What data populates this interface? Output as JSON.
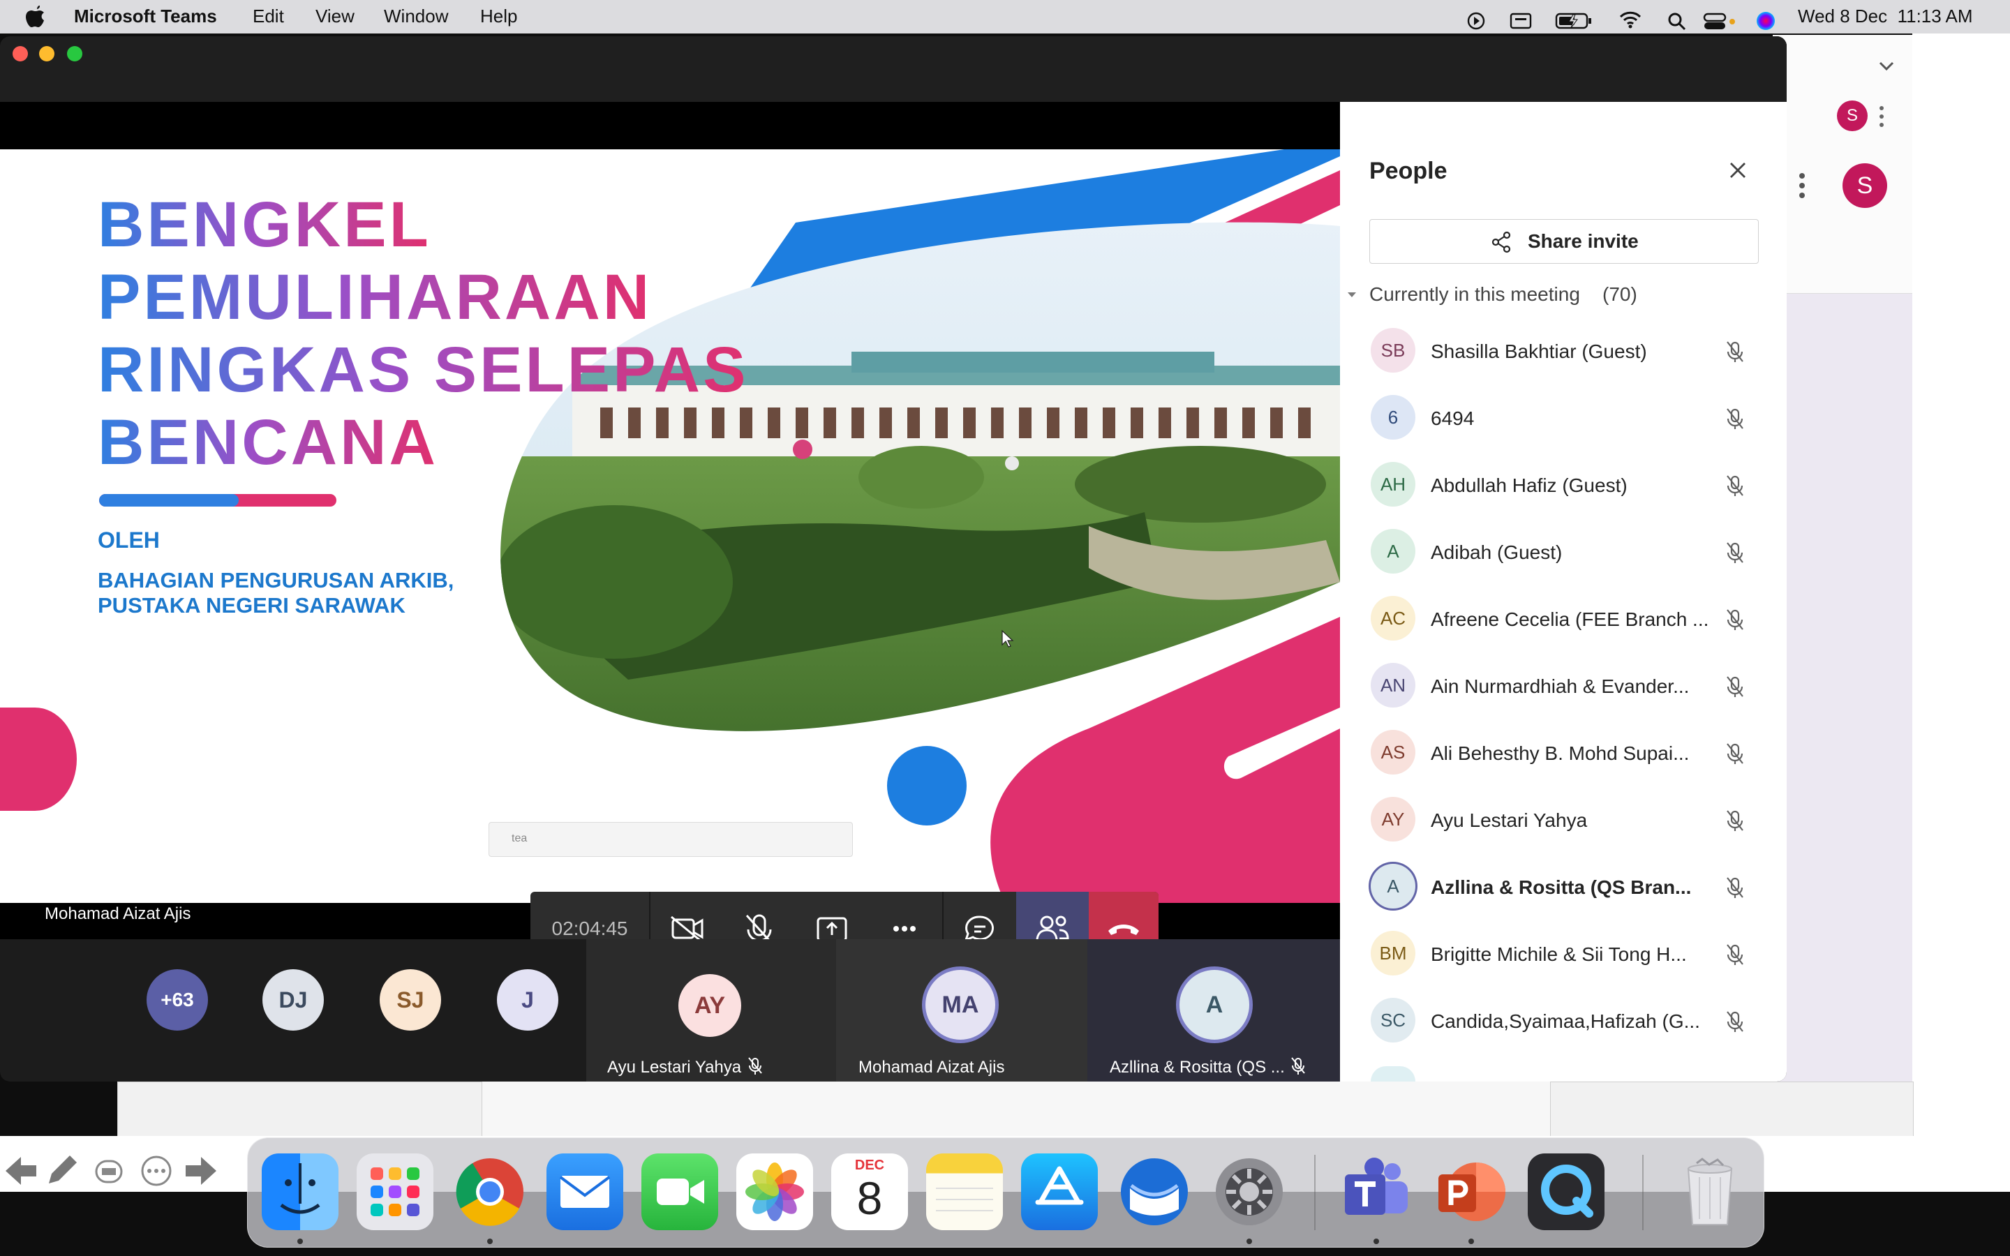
{
  "menubar": {
    "app_name": "Microsoft Teams",
    "menus": [
      "Edit",
      "View",
      "Window",
      "Help"
    ],
    "datetime": "Wed 8 Dec  11:13 AM"
  },
  "slide": {
    "title_lines": [
      "BENGKEL",
      "PEMULIHARAAN",
      "RINGKAS SELEPAS",
      "BENCANA"
    ],
    "by_label": "OLEH",
    "org_lines": [
      "BAHAGIAN PENGURUSAN ARKIB,",
      "PUSTAKA NEGERI SARAWAK"
    ]
  },
  "speaker_name": "Mohamad Aizat Ajis",
  "call": {
    "timer": "02:04:45",
    "mini_tab_text": "tea"
  },
  "gallery": {
    "overflow": "+63",
    "small_avatars": [
      {
        "initials": "DJ",
        "color": "#dfe3ea",
        "text_color": "#3b4a5e"
      },
      {
        "initials": "SJ",
        "color": "#fbe7d3",
        "text_color": "#8a5a2b"
      },
      {
        "initials": "J",
        "color": "#e3e2f4",
        "text_color": "#4a4a82"
      }
    ],
    "tiles": [
      {
        "initials": "AY",
        "name": "Ayu Lestari Yahya",
        "color": "#fbe0e0",
        "text_color": "#8b3a3a",
        "muted": true
      },
      {
        "initials": "MA",
        "name": "Mohamad Aizat Ajis",
        "color": "#e5e3f3",
        "text_color": "#44426f",
        "muted": false
      },
      {
        "initials": "A",
        "name": "Azllina & Rositta (QS ...",
        "color": "#dde9ef",
        "text_color": "#3b5866",
        "muted": true
      }
    ]
  },
  "people_panel": {
    "title": "People",
    "share_invite": "Share invite",
    "section_label": "Currently in this meeting",
    "count": "(70)",
    "participants": [
      {
        "initials": "SB",
        "name": "Shasilla Bakhtiar (Guest)",
        "color": "#f4e1ea",
        "text_color": "#7a3b58",
        "bold": false
      },
      {
        "initials": "6",
        "name": "6494",
        "color": "#dde6f5",
        "text_color": "#2f4a7a",
        "bold": false
      },
      {
        "initials": "AH",
        "name": "Abdullah Hafiz (Guest)",
        "color": "#dcefe4",
        "text_color": "#2e6b47",
        "bold": false
      },
      {
        "initials": "A",
        "name": "Adibah (Guest)",
        "color": "#dcefe4",
        "text_color": "#2e6b47",
        "bold": false
      },
      {
        "initials": "AC",
        "name": "Afreene Cecelia (FEE Branch ...",
        "color": "#fbf0d4",
        "text_color": "#7a5a15",
        "bold": false
      },
      {
        "initials": "AN",
        "name": "Ain Nurmardhiah & Evander...",
        "color": "#e6e4f2",
        "text_color": "#4a4673",
        "bold": false
      },
      {
        "initials": "AS",
        "name": "Ali Behesthy B. Mohd Supai...",
        "color": "#f8e1dc",
        "text_color": "#7e3b2e",
        "bold": false
      },
      {
        "initials": "AY",
        "name": "Ayu Lestari Yahya",
        "color": "#f8e1dc",
        "text_color": "#7e3b2e",
        "bold": false
      },
      {
        "initials": "A",
        "name": "Azllina & Rositta (QS Bran...",
        "color": "#dde9ef",
        "text_color": "#3b5866",
        "bold": true
      },
      {
        "initials": "BM",
        "name": "Brigitte Michile & Sii Tong H...",
        "color": "#fbf0d4",
        "text_color": "#7a5a15",
        "bold": false
      },
      {
        "initials": "SC",
        "name": "Candida,Syaimaa,Hafizah (G...",
        "color": "#e1ebf0",
        "text_color": "#3b5866",
        "bold": false
      }
    ]
  },
  "chrome_avatar": "S",
  "dock": {
    "calendar_month": "DEC",
    "calendar_day": "8"
  },
  "colors": {
    "teams_purple": "#6264a7",
    "hangup_red": "#c4314b",
    "slide_blue": "#1c78cc",
    "slide_pink": "#e0306e"
  }
}
